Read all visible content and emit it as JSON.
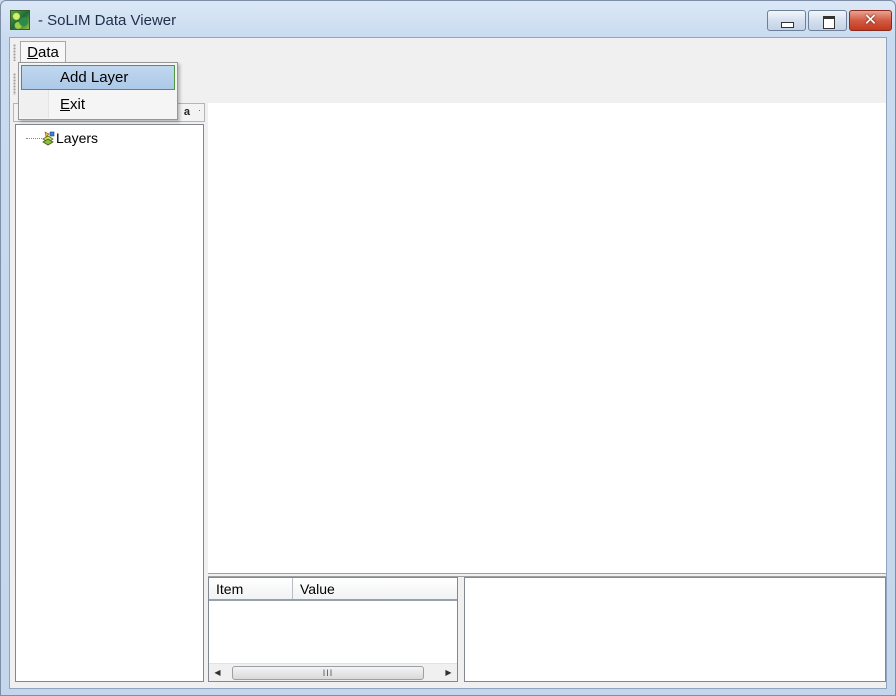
{
  "window": {
    "title": " - SoLIM Data Viewer",
    "icon": "solim-app-icon",
    "controls": {
      "minimize": "minimize-icon",
      "maximize": "maximize-icon",
      "close": "✕"
    }
  },
  "menubar": {
    "items": [
      {
        "label_underlined": "D",
        "label_rest": "ata"
      }
    ]
  },
  "dropdown": {
    "items": [
      {
        "label": "Add Layer",
        "highlighted": true
      },
      {
        "label_underlined": "E",
        "label_rest": "xit",
        "highlighted": false
      }
    ]
  },
  "left_panel": {
    "header_fragment": "a",
    "tree": {
      "root": {
        "label": "Layers",
        "icon": "layers-icon"
      }
    }
  },
  "properties_grid": {
    "columns": [
      "Item",
      "Value"
    ],
    "scroll": {
      "left_arrow": "◀",
      "right_arrow": "▶",
      "thumb_grip": "III"
    }
  },
  "colors": {
    "menu_highlight": "#adc9e8",
    "menu_highlight_border": "#4d9a3f",
    "close_button": "#c2391f"
  }
}
